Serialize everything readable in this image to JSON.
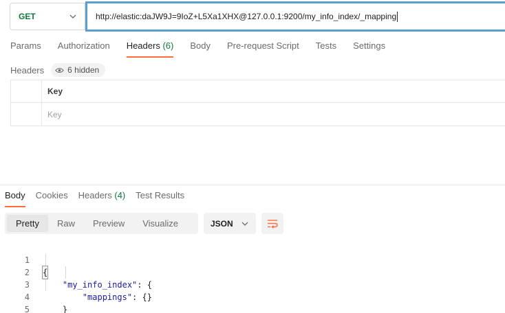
{
  "request": {
    "method": "GET",
    "url": "http://elastic:daJW9J=9IoZ+L5Xa1XHX@127.0.0.1:9200/my_info_index/_mapping"
  },
  "request_tabs": [
    {
      "label": "Params"
    },
    {
      "label": "Authorization"
    },
    {
      "label": "Headers",
      "count": "(6)",
      "active": true
    },
    {
      "label": "Body"
    },
    {
      "label": "Pre-request Script"
    },
    {
      "label": "Tests"
    },
    {
      "label": "Settings"
    }
  ],
  "headers_panel": {
    "title": "Headers",
    "hidden_label": "6 hidden",
    "column_key": "Key",
    "key_placeholder": "Key"
  },
  "response_tabs": [
    {
      "label": "Body",
      "active": true
    },
    {
      "label": "Cookies"
    },
    {
      "label": "Headers",
      "count": "(4)"
    },
    {
      "label": "Test Results"
    }
  ],
  "view_modes": [
    {
      "label": "Pretty",
      "active": true
    },
    {
      "label": "Raw"
    },
    {
      "label": "Preview"
    },
    {
      "label": "Visualize"
    }
  ],
  "format": "JSON",
  "code_lines": [
    {
      "n": "1",
      "text": "{"
    },
    {
      "n": "2",
      "key": "\"my_info_index\"",
      "rest": ": {"
    },
    {
      "n": "3",
      "key": "\"mappings\"",
      "rest": ": {}"
    },
    {
      "n": "4",
      "text": "}"
    },
    {
      "n": "5",
      "text": "}"
    }
  ],
  "colors": {
    "accent": "#ff6c37",
    "method_get": "#0b7a3b",
    "url_focus_border": "#5a9fd4"
  }
}
